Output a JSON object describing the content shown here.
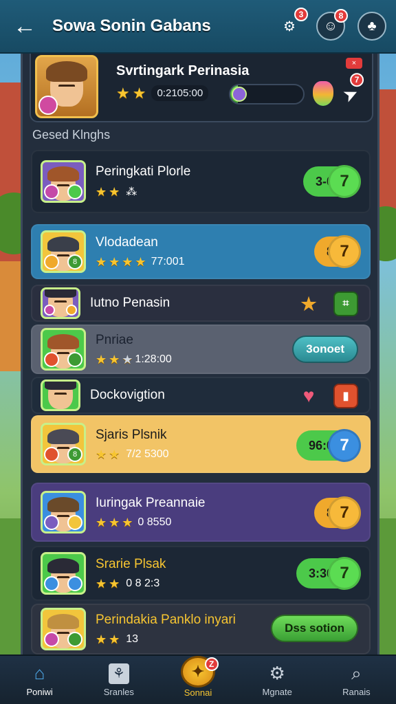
{
  "header": {
    "title": "Sowa Sonin Gabans",
    "icons": [
      {
        "name": "gear-icon",
        "badge": "3"
      },
      {
        "name": "profile-icon",
        "badge": "8"
      },
      {
        "name": "map-pin-icon",
        "badge": ""
      }
    ]
  },
  "profile": {
    "name": "Svrtingark Perinasia",
    "stars": 2,
    "timer": "0:2105:00",
    "progress": 0.1,
    "flag_badge": "×",
    "send_badge": "7"
  },
  "section_label": "Gesed Klnghs",
  "rows": [
    {
      "name": "Peringkati Plorle",
      "stars": 2,
      "extra": "⁂",
      "action": "3-0",
      "action_icon": "7",
      "style": "dark",
      "button": "green-pill"
    },
    {
      "name": "Vlodadean",
      "stars": 4,
      "extra": "77:001",
      "action": "8",
      "action_icon": "7",
      "style": "blue",
      "button": "orange-pill"
    },
    {
      "name": "Iutno Penasin",
      "stars": 0,
      "extra": "",
      "action": "",
      "action_icon": "",
      "style": "dark",
      "button": "icons"
    },
    {
      "name": "Pnriae",
      "stars": 2,
      "extra": "1:28:00",
      "action": "3onoet",
      "action_icon": "",
      "style": "gray",
      "button": "teal"
    },
    {
      "name": "Dockovigtion",
      "stars": 0,
      "extra": "",
      "action": "",
      "action_icon": "",
      "style": "dark",
      "button": "heart"
    },
    {
      "name": "Sjaris Plsnik",
      "stars": 2,
      "extra": "7/2 5300",
      "action": "96:0",
      "action_icon": "7",
      "style": "gold",
      "button": "blue-pill"
    },
    {
      "name": "Iuringak Preannaie",
      "stars": 3,
      "extra": "0 8550",
      "action": "8",
      "action_icon": "7",
      "style": "purple",
      "button": "orange-pill"
    },
    {
      "name": "Srarie Plsak",
      "stars": 2,
      "extra": "0 8 2:3",
      "action": "3:30",
      "action_icon": "7",
      "style": "dark",
      "button": "green-pill"
    },
    {
      "name": "Perindakia Panklo inyari",
      "stars": 2,
      "extra": "13",
      "action": "Dss sotion",
      "action_icon": "",
      "style": "dark",
      "button": "green-wide"
    }
  ],
  "nav": [
    {
      "label": "Poniwi",
      "icon": "home-icon"
    },
    {
      "label": "Sranles",
      "icon": "scroll-icon"
    },
    {
      "label": "Sonnai",
      "icon": "center-quest-icon",
      "badge": "Z"
    },
    {
      "label": "Mgnate",
      "icon": "gear-icon"
    },
    {
      "label": "Ranais",
      "icon": "search-icon"
    }
  ],
  "colors": {
    "topbar": "#1f5b78",
    "panel": "#232e3d",
    "accent_gold": "#f7c531",
    "accent_green": "#4cc94a",
    "badge_red": "#e23b3b"
  }
}
